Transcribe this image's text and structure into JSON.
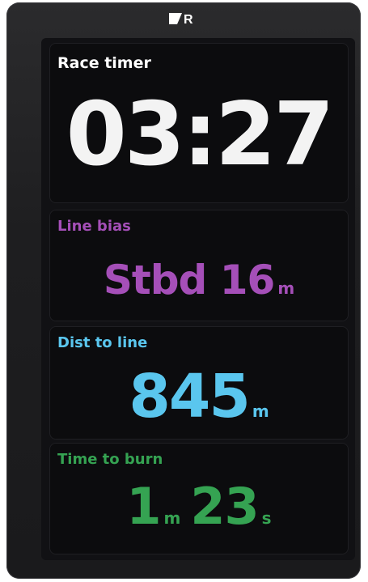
{
  "brand": {
    "logo_text": "R"
  },
  "panels": {
    "race_timer": {
      "title": "Race timer",
      "value": "03:27"
    },
    "line_bias": {
      "title": "Line bias",
      "value": "Stbd 16",
      "unit": "m"
    },
    "dist_to_line": {
      "title": "Dist to line",
      "value": "845",
      "unit": "m"
    },
    "time_to_burn": {
      "title": "Time to burn",
      "minutes_value": "1",
      "minutes_unit": "m",
      "seconds_value": "23",
      "seconds_unit": "s"
    }
  },
  "colors": {
    "race_timer": "#f3f3f3",
    "line_bias": "#a54fb8",
    "dist_to_line": "#5ac6ee",
    "time_to_burn": "#35a352"
  }
}
